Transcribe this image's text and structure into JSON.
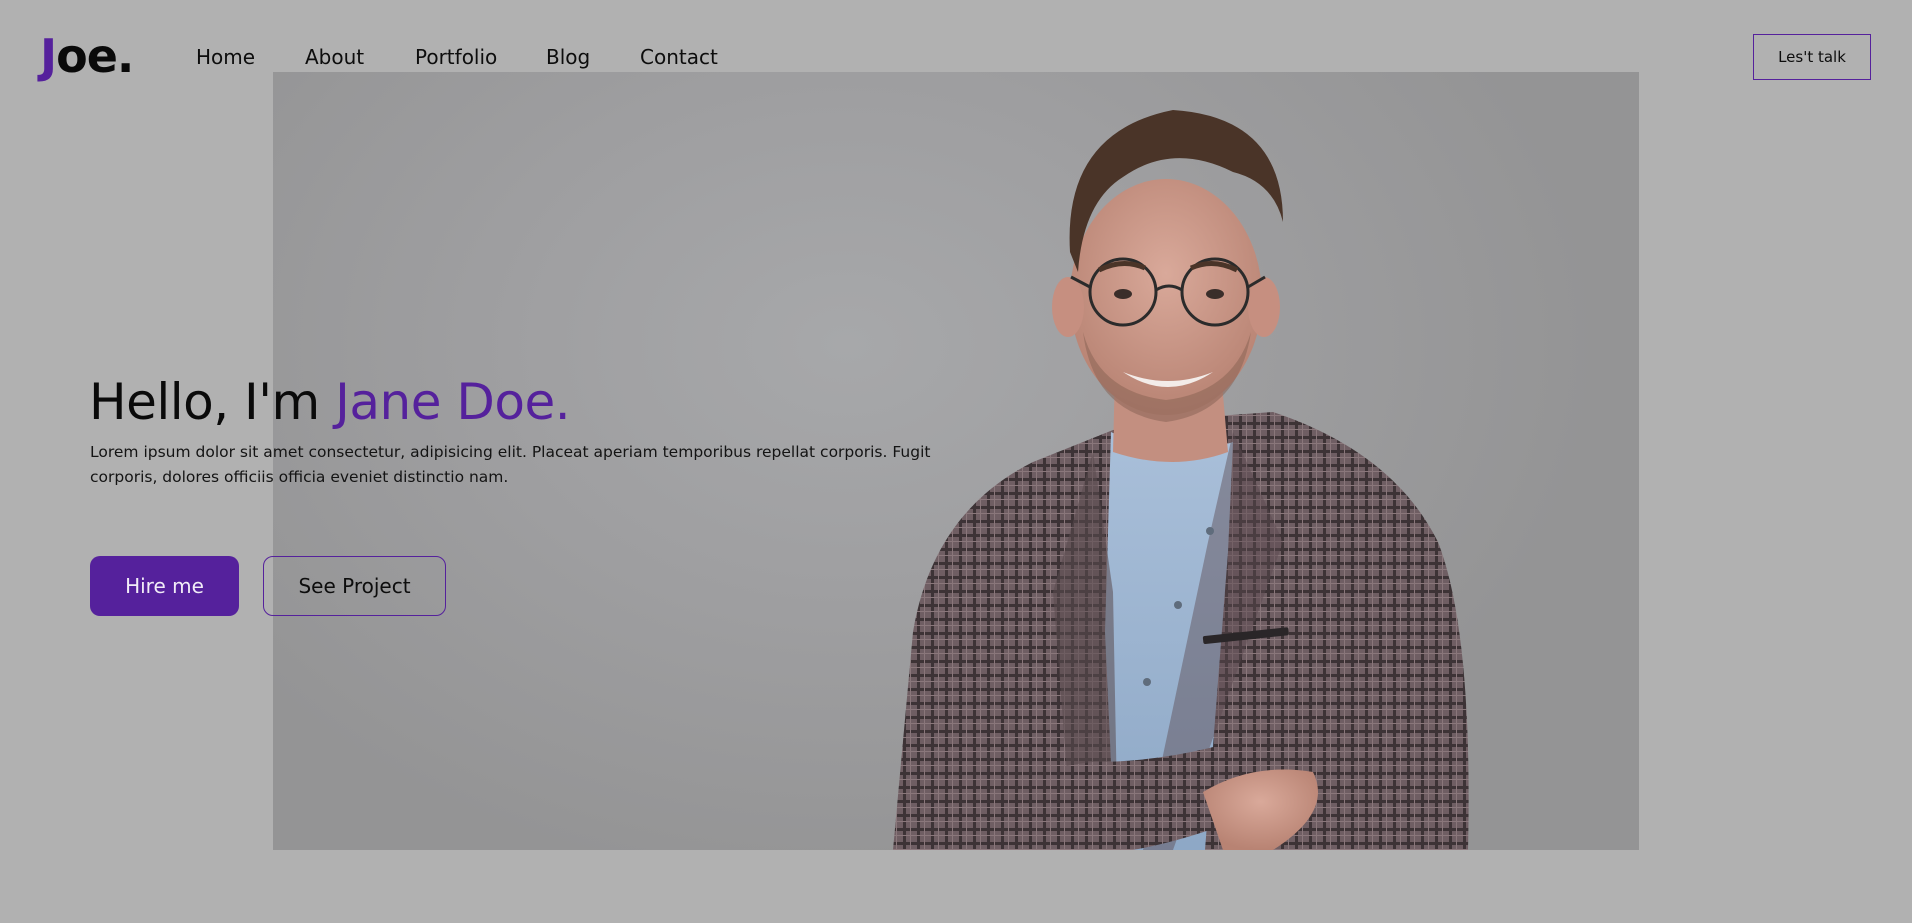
{
  "brand": {
    "logo_first": "J",
    "logo_rest": "oe."
  },
  "nav": {
    "items": [
      {
        "label": "Home"
      },
      {
        "label": "About"
      },
      {
        "label": "Portfolio"
      },
      {
        "label": "Blog"
      },
      {
        "label": "Contact"
      }
    ],
    "cta_label": "Les't talk"
  },
  "hero": {
    "greeting": "Hello, I'm ",
    "name": "Jane Doe.",
    "description": "Lorem ipsum dolor sit amet consectetur, adipisicing elit. Placeat aperiam temporibus repellat corporis. Fugit corporis, dolores officiis officia eveniet distinctio nam.",
    "primary_button": "Hire me",
    "secondary_button": "See Project"
  },
  "colors": {
    "accent": "#55219c",
    "page_background": "#b1b1b1",
    "text": "#0d0d0d"
  },
  "icons": {
    "hero_image": "man-portrait-photo"
  }
}
